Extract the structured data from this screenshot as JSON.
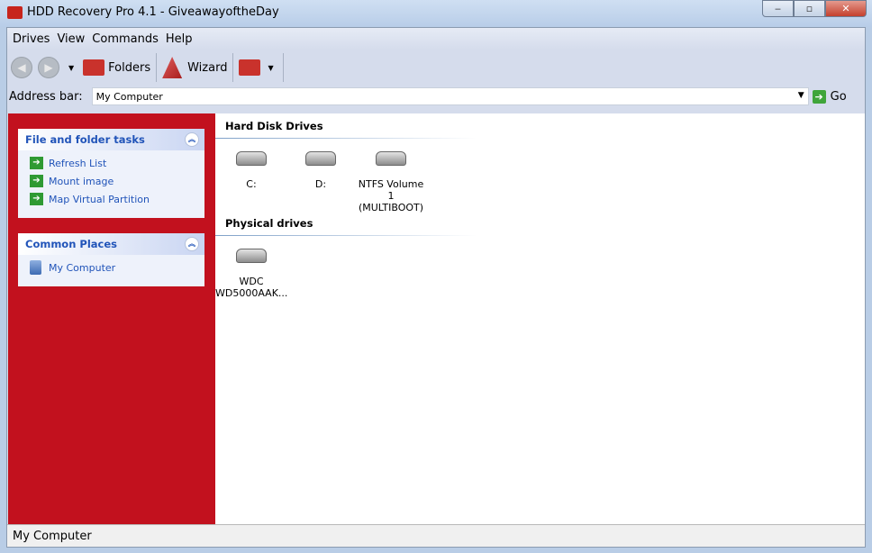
{
  "window": {
    "title": "HDD Recovery Pro 4.1 - GiveawayoftheDay",
    "minimize": "‒",
    "maximize": "▫",
    "close": "✕"
  },
  "menu": [
    "Drives",
    "View",
    "Commands",
    "Help"
  ],
  "toolbar": {
    "folders": "Folders",
    "wizard": "Wizard"
  },
  "address": {
    "label": "Address bar:",
    "value": "My Computer",
    "go": "Go"
  },
  "sidebar": {
    "tasks": {
      "title": "File and folder tasks",
      "items": [
        "Refresh List",
        "Mount image",
        "Map Virtual Partition"
      ]
    },
    "places": {
      "title": "Common Places",
      "items": [
        "My Computer"
      ]
    }
  },
  "content": {
    "hard_disk_title": "Hard Disk Drives",
    "hard_disks": [
      {
        "l1": "C:",
        "l2": ""
      },
      {
        "l1": "D:",
        "l2": ""
      },
      {
        "l1": "NTFS Volume 1",
        "l2": "(MULTIBOOT)"
      }
    ],
    "physical_title": "Physical drives",
    "physical": [
      {
        "l1": "WDC",
        "l2": "WD5000AAK..."
      }
    ]
  },
  "status": "My Computer"
}
